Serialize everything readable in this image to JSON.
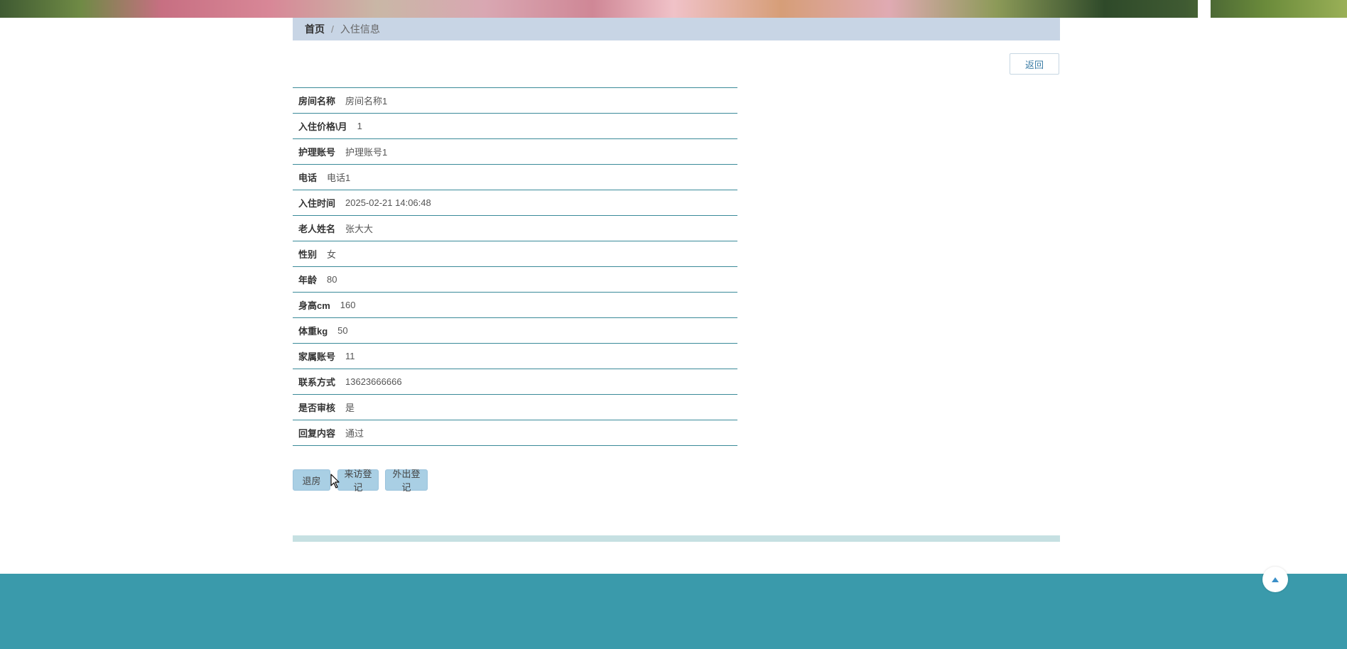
{
  "breadcrumb": {
    "home": "首页",
    "separator": "/",
    "current": "入住信息"
  },
  "back_label": "返回",
  "fields": [
    {
      "label": "房间名称",
      "value": "房间名称1"
    },
    {
      "label": "入住价格\\月",
      "value": "1"
    },
    {
      "label": "护理账号",
      "value": "护理账号1"
    },
    {
      "label": "电话",
      "value": "电话1"
    },
    {
      "label": "入住时间",
      "value": "2025-02-21 14:06:48"
    },
    {
      "label": "老人姓名",
      "value": "张大大"
    },
    {
      "label": "性别",
      "value": "女"
    },
    {
      "label": "年龄",
      "value": "80"
    },
    {
      "label": "身高cm",
      "value": "160"
    },
    {
      "label": "体重kg",
      "value": "50"
    },
    {
      "label": "家属账号",
      "value": "11"
    },
    {
      "label": "联系方式",
      "value": "13623666666"
    },
    {
      "label": "是否审核",
      "value": "是"
    },
    {
      "label": "回复内容",
      "value": "通过"
    }
  ],
  "actions": {
    "checkout": "退房",
    "visit_register": "来访登记",
    "outing_register": "外出登记"
  },
  "icons": {
    "to_top": "caret-up-icon",
    "cursor": "mouse-pointer-icon"
  },
  "colors": {
    "breadcrumb_bg": "#c8d5e5",
    "row_border": "#3a8a99",
    "button_bg": "#a9cfe4",
    "footer_bg": "#3a9aab"
  }
}
